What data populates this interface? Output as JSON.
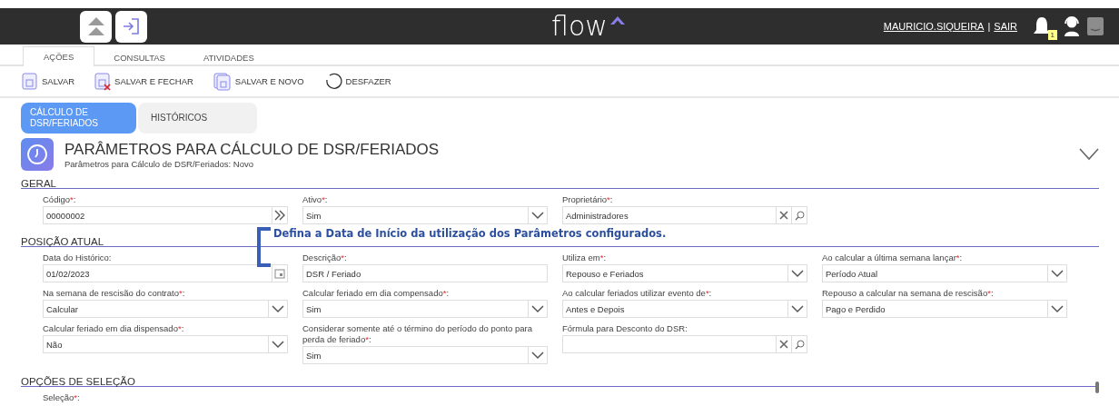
{
  "header": {
    "logo": "flow",
    "user_link": "MAURICIO.SIQUEIRA",
    "separator": "|",
    "logout_link": "SAIR",
    "notification_count": "1"
  },
  "tabs": [
    {
      "label": "AÇÕES",
      "selected": true
    },
    {
      "label": "CONSULTAS",
      "selected": false
    },
    {
      "label": "ATIVIDADES",
      "selected": false
    }
  ],
  "toolbar": [
    {
      "label": "SALVAR",
      "kind": "save"
    },
    {
      "label": "SALVAR E FECHAR",
      "kind": "save_close"
    },
    {
      "label": "SALVAR E NOVO",
      "kind": "save_new"
    },
    {
      "label": "DESFAZER",
      "kind": "undo"
    }
  ],
  "subtabs": [
    {
      "label": "CÁLCULO DE DSR/FERIADOS",
      "selected": true
    },
    {
      "label": "HISTÓRICOS",
      "selected": false
    }
  ],
  "page": {
    "title": "PARÂMETROS PARA CÁLCULO DE DSR/FERIADOS",
    "subtitle": "Parâmetros para Cálculo de DSR/Feriados: Novo"
  },
  "sections": [
    {
      "title": "GERAL",
      "fields": [
        {
          "label": "Código",
          "required_mark": "*",
          "suffix": ":",
          "kind": "next",
          "value": "00000002"
        },
        {
          "label": "Ativo",
          "required_mark": "*",
          "suffix": ":",
          "kind": "select",
          "value": "Sim"
        },
        {
          "label": "Proprietário",
          "required_mark": "*",
          "suffix": ":",
          "kind": "lookup",
          "value": "Administradores"
        }
      ]
    },
    {
      "title": "POSIÇÃO ATUAL",
      "callout": "Defina a Data de Início da utilização dos Parâmetros configurados.",
      "fields": [
        {
          "label": "Data do Histórico:",
          "kind": "date",
          "value": "01/02/2023"
        },
        {
          "label": "Descrição",
          "required_mark": "*",
          "suffix": ":",
          "kind": "text",
          "value": "DSR / Feriado"
        },
        {
          "label": "Utiliza em",
          "required_mark": "*",
          "suffix": ":",
          "kind": "select",
          "value": "Repouso e Feriados"
        },
        {
          "label": "Ao calcular a última semana lançar",
          "required_mark": "*",
          "suffix": ":",
          "kind": "select",
          "value": "Período Atual"
        },
        {
          "label": "Na semana de rescisão do contrato",
          "required_mark": "*",
          "suffix": ":",
          "kind": "select",
          "value": "Calcular"
        },
        {
          "label": "Calcular feriado em dia compensado",
          "required_mark": "*",
          "suffix": ":",
          "kind": "select",
          "value": "Sim"
        },
        {
          "label": "Ao calcular feriados utilizar evento de",
          "required_mark": "*",
          "suffix": ":",
          "kind": "select",
          "value": "Antes e Depois"
        },
        {
          "label": "Repouso a calcular na semana de rescisão",
          "required_mark": "*",
          "suffix": ":",
          "kind": "select",
          "value": "Pago e Perdido"
        },
        {
          "label": "Calcular feriado em dia dispensado",
          "required_mark": "*",
          "suffix": ":",
          "kind": "select",
          "value": "Não"
        },
        {
          "label": "Considerar somente até o término do período do ponto para perda de feriado",
          "required_mark": "*",
          "suffix": ":",
          "kind": "select",
          "value": "Sim"
        },
        {
          "label": "Fórmula para Desconto do DSR:",
          "kind": "lookup"
        }
      ]
    },
    {
      "title": "OPÇÕES DE SELEÇÃO",
      "fields": [
        {
          "label": "Seleção",
          "required_mark": "*",
          "suffix": ":"
        }
      ]
    }
  ]
}
